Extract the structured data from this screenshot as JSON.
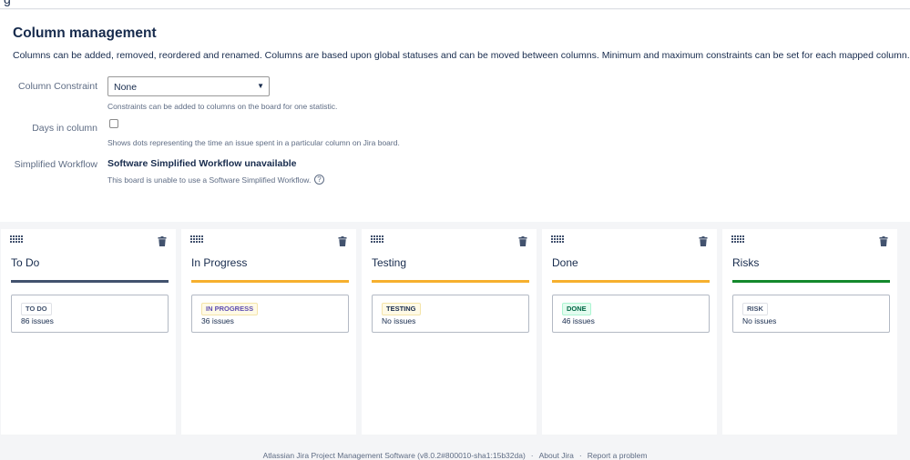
{
  "settings": {
    "title": "Column management",
    "description": "Columns can be added, removed, reordered and renamed. Columns are based upon global statuses and can be moved between columns. Minimum and maximum constraints can be set for each mapped column.",
    "constraint_label": "Column Constraint",
    "constraint_value": "None",
    "constraint_help": "Constraints can be added to columns on the board for one statistic.",
    "days_label": "Days in column",
    "days_checked": false,
    "days_help": "Shows dots representing the time an issue spent in a particular column on Jira board.",
    "workflow_label": "Simplified Workflow",
    "workflow_value": "Software Simplified Workflow unavailable",
    "workflow_help": "This board is unable to use a Software Simplified Workflow."
  },
  "columns": [
    {
      "title": "To Do",
      "bar_color": "#42526e",
      "status": "TO DO",
      "status_bg": "#fff",
      "status_fg": "#42526e",
      "status_border": "#dfe1e6",
      "count": "86 issues"
    },
    {
      "title": "In Progress",
      "bar_color": "#f6b02e",
      "status": "IN PROGRESS",
      "status_bg": "#fffae6",
      "status_fg": "#5e4db2",
      "status_border": "#f4e4a9",
      "count": "36 issues"
    },
    {
      "title": "Testing",
      "bar_color": "#f6b02e",
      "status": "TESTING",
      "status_bg": "#fffae6",
      "status_fg": "#172b4d",
      "status_border": "#f4e4a9",
      "count": "No issues"
    },
    {
      "title": "Done",
      "bar_color": "#f6b02e",
      "status": "DONE",
      "status_bg": "#e3fcef",
      "status_fg": "#006644",
      "status_border": "#abf5d1",
      "count": "46 issues"
    },
    {
      "title": "Risks",
      "bar_color": "#14892c",
      "status": "RISK",
      "status_bg": "#fff",
      "status_fg": "#42526e",
      "status_border": "#dfe1e6",
      "count": "No issues"
    }
  ],
  "footer": {
    "product": "Atlassian Jira Project Management Software (v8.0.2#800010-sha1:15b32da)",
    "about": "About Jira",
    "report": "Report a problem"
  },
  "icons": {
    "grip": "drag-handle-icon",
    "trash": "trash-icon",
    "help": "question-circle-icon",
    "dropdown": "caret-down-icon"
  }
}
